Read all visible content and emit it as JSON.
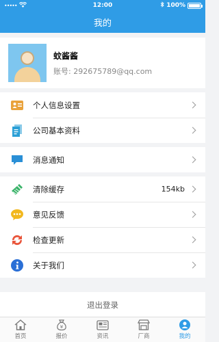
{
  "status": {
    "carrier_dots": "•••••",
    "time": "12:00",
    "battery_text": "100%",
    "battery_level": 1.0
  },
  "nav": {
    "title": "我的"
  },
  "profile": {
    "nickname": "蚊酱酱",
    "account": "账号: 292675789@qq.com"
  },
  "groups": [
    [
      {
        "label": "个人信息设置",
        "icon": "id-card-icon",
        "color": "#e9a23b"
      },
      {
        "label": "公司基本资料",
        "icon": "document-icon",
        "color": "#2a9fd6"
      }
    ],
    [
      {
        "label": "消息通知",
        "icon": "chat-bubble-icon",
        "color": "#2a8fd6"
      }
    ],
    [
      {
        "label": "清除缓存",
        "icon": "broom-icon",
        "color": "#3bb36a",
        "value": "154kb"
      },
      {
        "label": "意见反馈",
        "icon": "speech-dots-icon",
        "color": "#f2b81f"
      },
      {
        "label": "检查更新",
        "icon": "refresh-icon",
        "color": "#e9553b"
      },
      {
        "label": "关于我们",
        "icon": "info-icon",
        "color": "#2a6fd6"
      }
    ]
  ],
  "logout": {
    "label": "退出登录"
  },
  "tabs": [
    {
      "label": "首页",
      "icon": "home-icon"
    },
    {
      "label": "报价",
      "icon": "money-bag-icon"
    },
    {
      "label": "资讯",
      "icon": "news-icon"
    },
    {
      "label": "厂商",
      "icon": "store-icon"
    },
    {
      "label": "我的",
      "icon": "user-icon",
      "active": true
    }
  ]
}
